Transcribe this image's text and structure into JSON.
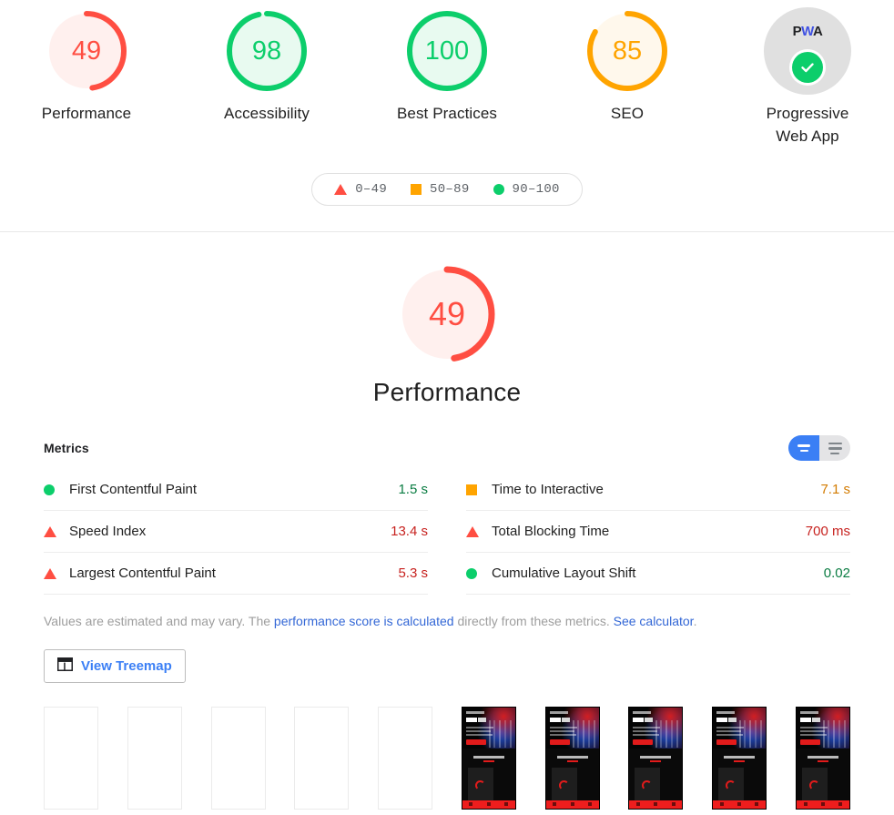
{
  "scores": [
    {
      "label": "Performance",
      "value": 49,
      "display": "49",
      "status": "fail",
      "color": "#ff4e42",
      "bg": "#fff0ee"
    },
    {
      "label": "Accessibility",
      "value": 98,
      "display": "98",
      "status": "pass",
      "color": "#0cce6b",
      "bg": "#e8faf0"
    },
    {
      "label": "Best Practices",
      "value": 100,
      "display": "100",
      "status": "pass",
      "color": "#0cce6b",
      "bg": "#e8faf0"
    },
    {
      "label": "SEO",
      "value": 85,
      "display": "85",
      "status": "average",
      "color": "#ffa400",
      "bg": "#fff8ec"
    }
  ],
  "pwa": {
    "label_line1": "Progressive",
    "label_line2": "Web App",
    "badge_p": "P",
    "badge_w": "W",
    "badge_a": "A",
    "check_icon": "check-icon",
    "circle_color": "#e0e0e0",
    "check_color": "#0cce6b"
  },
  "legend": [
    {
      "icon": "triangle",
      "range": "0–49",
      "color": "#ff4e42"
    },
    {
      "icon": "square",
      "range": "50–89",
      "color": "#ffa400"
    },
    {
      "icon": "circle",
      "range": "90–100",
      "color": "#0cce6b"
    }
  ],
  "category": {
    "score": 49,
    "score_display": "49",
    "title": "Performance",
    "color": "#ff4e42",
    "bg": "#fff0ee"
  },
  "metrics_section": {
    "title": "Metrics",
    "toggle": {
      "expand_label": "expanded-view-icon",
      "collapse_label": "collapsed-view-icon",
      "active": "expanded",
      "active_color": "#3b7ff5"
    },
    "rows": [
      {
        "icon": "circle",
        "name": "First Contentful Paint",
        "value": "1.5 s",
        "status": "pass"
      },
      {
        "icon": "square",
        "name": "Time to Interactive",
        "value": "7.1 s",
        "status": "average"
      },
      {
        "icon": "triangle",
        "name": "Speed Index",
        "value": "13.4 s",
        "status": "fail"
      },
      {
        "icon": "triangle",
        "name": "Total Blocking Time",
        "value": "700 ms",
        "status": "fail"
      },
      {
        "icon": "triangle",
        "name": "Largest Contentful Paint",
        "value": "5.3 s",
        "status": "fail"
      },
      {
        "icon": "circle",
        "name": "Cumulative Layout Shift",
        "value": "0.02",
        "status": "pass"
      }
    ],
    "disclaimer": {
      "part1": "Values are estimated and may vary. The ",
      "link1": "performance score is calculated",
      "part2": " directly from these metrics. ",
      "link2": "See calculator",
      "part3": "."
    },
    "treemap_button": {
      "label": "View Treemap",
      "icon": "treemap-icon"
    }
  },
  "filmstrip": {
    "frames": [
      {
        "state": "blank"
      },
      {
        "state": "blank"
      },
      {
        "state": "blank"
      },
      {
        "state": "blank"
      },
      {
        "state": "blank"
      },
      {
        "state": "loaded"
      },
      {
        "state": "loaded"
      },
      {
        "state": "loaded"
      },
      {
        "state": "loaded"
      },
      {
        "state": "loaded"
      }
    ]
  }
}
